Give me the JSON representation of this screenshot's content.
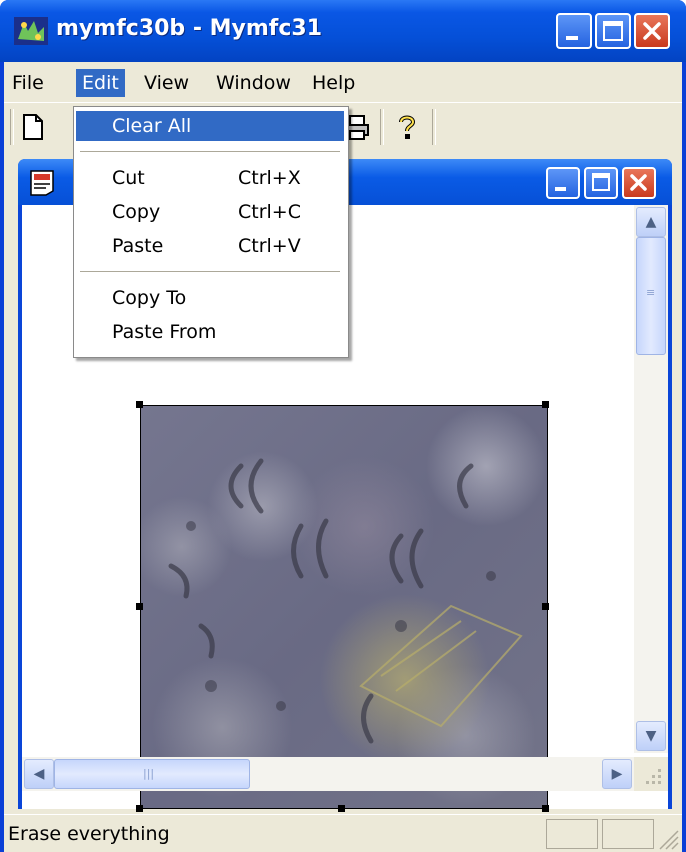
{
  "window": {
    "title": "mymfc30b - Mymfc31"
  },
  "menubar": [
    {
      "label": "File",
      "active": false
    },
    {
      "label": "Edit",
      "active": true
    },
    {
      "label": "View",
      "active": false
    },
    {
      "label": "Window",
      "active": false
    },
    {
      "label": "Help",
      "active": false
    }
  ],
  "edit_menu": {
    "items": [
      {
        "label": "Clear All",
        "shortcut": ""
      },
      {
        "label": "Cut",
        "shortcut": "Ctrl+X"
      },
      {
        "label": "Copy",
        "shortcut": "Ctrl+C"
      },
      {
        "label": "Paste",
        "shortcut": "Ctrl+V"
      },
      {
        "label": "Copy To",
        "shortcut": ""
      },
      {
        "label": "Paste From",
        "shortcut": ""
      }
    ],
    "highlighted": "Clear All"
  },
  "toolbar": {
    "icons": [
      "new-file-icon",
      "print-icon",
      "help-icon"
    ]
  },
  "status": {
    "text": "Erase everything"
  },
  "colors": {
    "titlebar": "#0a57e5",
    "menu_highlight": "#316ac5",
    "face": "#ece9d8"
  }
}
